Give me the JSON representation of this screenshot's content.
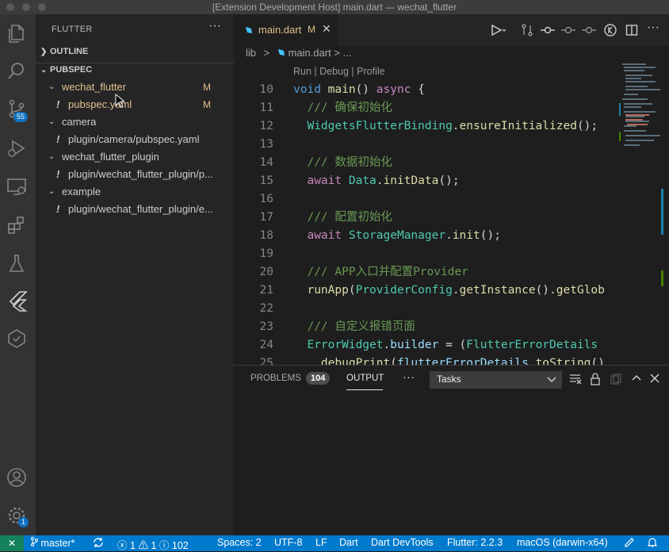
{
  "window": {
    "title": "[Extension Development Host] main.dart — wechat_flutter"
  },
  "activity": {
    "items": [
      "files-icon",
      "search-icon",
      "source-control-icon",
      "run-debug-icon",
      "remote-explorer-icon",
      "extensions-icon",
      "testing-icon",
      "flutter-icon",
      "pubspec-assist-icon"
    ],
    "scm_badge": "55",
    "manage_badge": "1"
  },
  "sidebar": {
    "header": "FLUTTER",
    "more": "···",
    "outline_label": "OUTLINE",
    "pubspec_label": "PUBSPEC",
    "tree": [
      {
        "label": "wechat_flutter",
        "modified": "M"
      },
      {
        "label": "pubspec.yaml",
        "modified": "M"
      },
      {
        "label": "camera"
      },
      {
        "label": "plugin/camera/pubspec.yaml"
      },
      {
        "label": "wechat_flutter_plugin"
      },
      {
        "label": "plugin/wechat_flutter_plugin/p..."
      },
      {
        "label": "example"
      },
      {
        "label": "plugin/wechat_flutter_plugin/e..."
      }
    ]
  },
  "editor": {
    "tab": {
      "name": "main.dart",
      "modified": "M"
    },
    "breadcrumb": {
      "folder": "lib",
      "sep": ">",
      "file": "main.dart",
      "rest": "> ..."
    },
    "codelens": "Run | Debug | Profile",
    "lines": [
      {
        "n": "10",
        "tokens": [
          [
            "kw",
            "void"
          ],
          [
            "pl",
            " "
          ],
          [
            "fn",
            "main"
          ],
          [
            "pl",
            "() "
          ],
          [
            "aw",
            "async"
          ],
          [
            "pl",
            " {"
          ]
        ]
      },
      {
        "n": "11",
        "tokens": [
          [
            "cm",
            "  /// 确保初始化"
          ]
        ]
      },
      {
        "n": "12",
        "tokens": [
          [
            "pl",
            "  "
          ],
          [
            "ty",
            "WidgetsFlutterBinding"
          ],
          [
            "pl",
            "."
          ],
          [
            "fn",
            "ensureInitialized"
          ],
          [
            "pl",
            "();"
          ]
        ]
      },
      {
        "n": "13",
        "tokens": []
      },
      {
        "n": "14",
        "tokens": [
          [
            "cm",
            "  /// 数据初始化"
          ]
        ]
      },
      {
        "n": "15",
        "tokens": [
          [
            "pl",
            "  "
          ],
          [
            "aw",
            "await"
          ],
          [
            "pl",
            " "
          ],
          [
            "ty",
            "Data"
          ],
          [
            "pl",
            "."
          ],
          [
            "fn",
            "initData"
          ],
          [
            "pl",
            "();"
          ]
        ]
      },
      {
        "n": "16",
        "tokens": []
      },
      {
        "n": "17",
        "tokens": [
          [
            "cm",
            "  /// 配置初始化"
          ]
        ]
      },
      {
        "n": "18",
        "tokens": [
          [
            "pl",
            "  "
          ],
          [
            "aw",
            "await"
          ],
          [
            "pl",
            " "
          ],
          [
            "ty",
            "StorageManager"
          ],
          [
            "pl",
            "."
          ],
          [
            "fn",
            "init"
          ],
          [
            "pl",
            "();"
          ]
        ]
      },
      {
        "n": "19",
        "tokens": []
      },
      {
        "n": "20",
        "tokens": [
          [
            "cm",
            "  /// APP入口并配置Provider"
          ]
        ]
      },
      {
        "n": "21",
        "tokens": [
          [
            "pl",
            "  "
          ],
          [
            "fn",
            "runApp"
          ],
          [
            "pl",
            "("
          ],
          [
            "ty",
            "ProviderConfig"
          ],
          [
            "pl",
            "."
          ],
          [
            "fn",
            "getInstance"
          ],
          [
            "pl",
            "()."
          ],
          [
            "fn",
            "getGlob"
          ]
        ]
      },
      {
        "n": "22",
        "tokens": []
      },
      {
        "n": "23",
        "tokens": [
          [
            "cm",
            "  /// 自定义报错页面"
          ]
        ]
      },
      {
        "n": "24",
        "tokens": [
          [
            "pl",
            "  "
          ],
          [
            "ty",
            "ErrorWidget"
          ],
          [
            "pl",
            "."
          ],
          [
            "ky",
            "builder"
          ],
          [
            "pl",
            " = ("
          ],
          [
            "ty",
            "FlutterErrorDetails"
          ]
        ]
      },
      {
        "n": "25",
        "tokens": [
          [
            "pl",
            "    "
          ],
          [
            "fn",
            "debugPrint"
          ],
          [
            "pl",
            "("
          ],
          [
            "ky",
            "flutterErrorDetails"
          ],
          [
            "pl",
            "."
          ],
          [
            "fn",
            "toString"
          ],
          [
            "pl",
            "()"
          ]
        ]
      }
    ]
  },
  "panel": {
    "problems_label": "PROBLEMS",
    "problems_count": "104",
    "output_label": "OUTPUT",
    "more": "···",
    "channel": "Tasks"
  },
  "status": {
    "branch": "master*",
    "errors": "1",
    "warnings": "1",
    "infos": "102",
    "spaces": "Spaces: 2",
    "encoding": "UTF-8",
    "eol": "LF",
    "language": "Dart",
    "devtools": "Dart DevTools",
    "flutter": "Flutter: 2.2.3",
    "device": "macOS (darwin-x64)"
  },
  "colors": {
    "accent": "#007acc",
    "modified": "#e2c08d",
    "remote": "#16825d"
  }
}
